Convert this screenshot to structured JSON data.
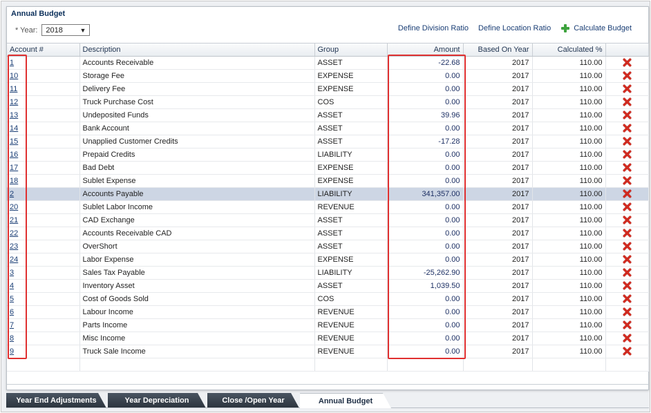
{
  "title": "Annual Budget",
  "year": {
    "label": "* Year:",
    "value": "2018"
  },
  "actions": {
    "define_division_ratio": "Define Division Ratio",
    "define_location_ratio": "Define Location Ratio",
    "calculate_budget": "Calculate Budget"
  },
  "columns": [
    "Account #",
    "Description",
    "Group",
    "Amount",
    "Based On Year",
    "Calculated %"
  ],
  "rows": [
    {
      "account": "1",
      "description": "Accounts Receivable",
      "group": "ASSET",
      "amount": "-22.68",
      "year": "2017",
      "pct": "110.00"
    },
    {
      "account": "10",
      "description": "Storage Fee",
      "group": "EXPENSE",
      "amount": "0.00",
      "year": "2017",
      "pct": "110.00"
    },
    {
      "account": "11",
      "description": "Delivery Fee",
      "group": "EXPENSE",
      "amount": "0.00",
      "year": "2017",
      "pct": "110.00"
    },
    {
      "account": "12",
      "description": "Truck Purchase Cost",
      "group": "COS",
      "amount": "0.00",
      "year": "2017",
      "pct": "110.00"
    },
    {
      "account": "13",
      "description": "Undeposited Funds",
      "group": "ASSET",
      "amount": "39.96",
      "year": "2017",
      "pct": "110.00"
    },
    {
      "account": "14",
      "description": "Bank Account",
      "group": "ASSET",
      "amount": "0.00",
      "year": "2017",
      "pct": "110.00"
    },
    {
      "account": "15",
      "description": "Unapplied Customer Credits",
      "group": "ASSET",
      "amount": "-17.28",
      "year": "2017",
      "pct": "110.00"
    },
    {
      "account": "16",
      "description": "Prepaid Credits",
      "group": "LIABILITY",
      "amount": "0.00",
      "year": "2017",
      "pct": "110.00"
    },
    {
      "account": "17",
      "description": "Bad Debt",
      "group": "EXPENSE",
      "amount": "0.00",
      "year": "2017",
      "pct": "110.00"
    },
    {
      "account": "18",
      "description": "Sublet Expense",
      "group": "EXPENSE",
      "amount": "0.00",
      "year": "2017",
      "pct": "110.00"
    },
    {
      "account": "2",
      "description": "Accounts Payable",
      "group": "LIABILITY",
      "amount": "341,357.00",
      "year": "2017",
      "pct": "110.00",
      "selected": true
    },
    {
      "account": "20",
      "description": "Sublet Labor Income",
      "group": "REVENUE",
      "amount": "0.00",
      "year": "2017",
      "pct": "110.00"
    },
    {
      "account": "21",
      "description": "CAD Exchange",
      "group": "ASSET",
      "amount": "0.00",
      "year": "2017",
      "pct": "110.00"
    },
    {
      "account": "22",
      "description": "Accounts Receivable CAD",
      "group": "ASSET",
      "amount": "0.00",
      "year": "2017",
      "pct": "110.00"
    },
    {
      "account": "23",
      "description": "OverShort",
      "group": "ASSET",
      "amount": "0.00",
      "year": "2017",
      "pct": "110.00"
    },
    {
      "account": "24",
      "description": "Labor Expense",
      "group": "EXPENSE",
      "amount": "0.00",
      "year": "2017",
      "pct": "110.00"
    },
    {
      "account": "3",
      "description": "Sales Tax Payable",
      "group": "LIABILITY",
      "amount": "-25,262.90",
      "year": "2017",
      "pct": "110.00"
    },
    {
      "account": "4",
      "description": "Inventory Asset",
      "group": "ASSET",
      "amount": "1,039.50",
      "year": "2017",
      "pct": "110.00"
    },
    {
      "account": "5",
      "description": "Cost of Goods Sold",
      "group": "COS",
      "amount": "0.00",
      "year": "2017",
      "pct": "110.00"
    },
    {
      "account": "6",
      "description": "Labour Income",
      "group": "REVENUE",
      "amount": "0.00",
      "year": "2017",
      "pct": "110.00"
    },
    {
      "account": "7",
      "description": "Parts Income",
      "group": "REVENUE",
      "amount": "0.00",
      "year": "2017",
      "pct": "110.00"
    },
    {
      "account": "8",
      "description": "Misc Income",
      "group": "REVENUE",
      "amount": "0.00",
      "year": "2017",
      "pct": "110.00"
    },
    {
      "account": "9",
      "description": "Truck Sale Income",
      "group": "REVENUE",
      "amount": "0.00",
      "year": "2017",
      "pct": "110.00"
    }
  ],
  "tabs": [
    {
      "label": "Year End Adjustments"
    },
    {
      "label": "Year Depreciation"
    },
    {
      "label": "Close /Open Year"
    },
    {
      "label": "Annual Budget",
      "active": true
    }
  ],
  "colors": {
    "highlight": "#e03030",
    "selected_row": "#cdd6e4",
    "delete_icon": "#d42a1f",
    "link": "#1a3e75"
  },
  "icons": {
    "calculate": "plus-icon",
    "delete": "delete-x-icon",
    "dropdown": "chevron-down-icon"
  }
}
